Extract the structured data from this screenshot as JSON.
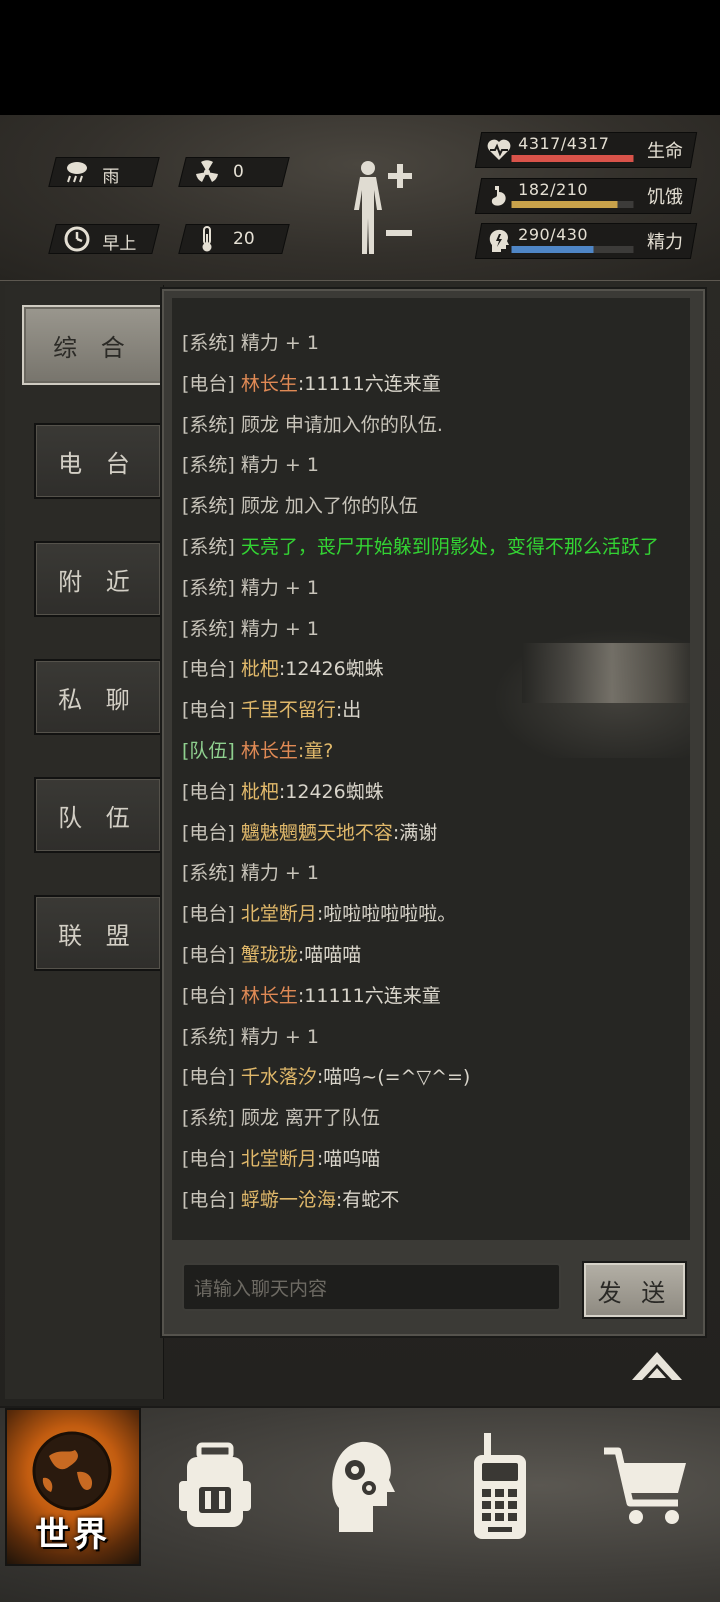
{
  "status": {
    "weather": "雨",
    "radiation": "0",
    "time_of_day": "早上",
    "temperature": "20",
    "health": {
      "value": "4317/4317",
      "label": "生命",
      "fill_fraction": 1.0,
      "color": "#d9534a"
    },
    "hunger": {
      "value": "182/210",
      "label": "饥饿",
      "fill_fraction": 0.867,
      "color": "#c9a24a"
    },
    "energy": {
      "value": "290/430",
      "label": "精力",
      "fill_fraction": 0.674,
      "color": "#4f86c6"
    }
  },
  "tabs": [
    "综 合",
    "电 台",
    "附 近",
    "私 聊",
    "队 伍",
    "联 盟"
  ],
  "active_tab": "综 合",
  "chat": {
    "messages": [
      {
        "tag": "[系统]",
        "name": "",
        "text": "精力 + 1"
      },
      {
        "tag": "[电台]",
        "name": "林长生",
        "text": ":11111六连来童"
      },
      {
        "tag": "[系统]",
        "name": "",
        "text": "顾龙 申请加入你的队伍."
      },
      {
        "tag": "[系统]",
        "name": "",
        "text": "精力 + 1"
      },
      {
        "tag": "[系统]",
        "name": "",
        "text": "顾龙 加入了你的队伍"
      },
      {
        "tag": "[系统]",
        "name": "",
        "text": "天亮了，丧尸开始躲到阴影处，变得不那么活跃了"
      },
      {
        "tag": "[系统]",
        "name": "",
        "text": "精力 + 1"
      },
      {
        "tag": "[系统]",
        "name": "",
        "text": "精力 + 1"
      },
      {
        "tag": "[电台]",
        "name": "枇杷",
        "text": ":12426蜘蛛"
      },
      {
        "tag": "[电台]",
        "name": "千里不留行",
        "text": ":出"
      },
      {
        "tag": "[队伍]",
        "name": "林长生",
        "text": ":童?"
      },
      {
        "tag": "[电台]",
        "name": "枇杷",
        "text": ":12426蜘蛛"
      },
      {
        "tag": "[电台]",
        "name": "魑魅魍魉天地不容",
        "text": ":满谢"
      },
      {
        "tag": "[系统]",
        "name": "",
        "text": "精力 + 1"
      },
      {
        "tag": "[电台]",
        "name": "北堂断月",
        "text": ":啦啦啦啦啦啦。"
      },
      {
        "tag": "[电台]",
        "name": "蟹珑珑",
        "text": ":喵喵喵"
      },
      {
        "tag": "[电台]",
        "name": "林长生",
        "text": ":11111六连来童"
      },
      {
        "tag": "[系统]",
        "name": "",
        "text": "精力 + 1"
      },
      {
        "tag": "[电台]",
        "name": "千水落汐",
        "text": ":喵呜~(=^▽^=)"
      },
      {
        "tag": "[系统]",
        "name": "",
        "text": "顾龙 离开了队伍"
      },
      {
        "tag": "[电台]",
        "name": "北堂断月",
        "text": ":喵呜喵"
      },
      {
        "tag": "[电台]",
        "name": "蜉蝣一沧海",
        "text": ":有蛇不"
      }
    ],
    "input_placeholder": "请输入聊天内容",
    "send_label": "发 送"
  },
  "bottom_nav": {
    "world_label": "世界",
    "items": [
      "world-icon",
      "backpack-icon",
      "skills-head-icon",
      "radio-icon",
      "shop-cart-icon"
    ]
  }
}
